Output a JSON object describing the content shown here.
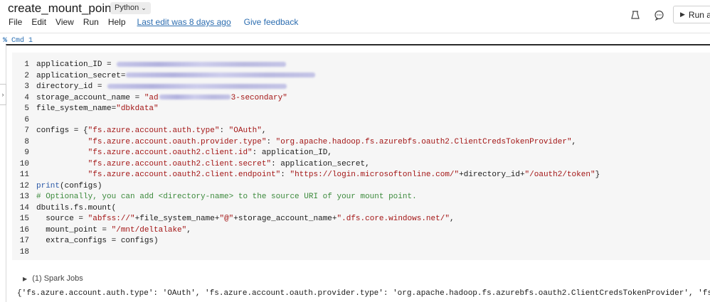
{
  "notebook": {
    "title": "create_mount_point",
    "language": "Python",
    "menu": [
      "File",
      "Edit",
      "View",
      "Run",
      "Help"
    ],
    "last_edit": "Last edit was 8 days ago",
    "feedback": "Give feedback",
    "run_label": "Run a"
  },
  "cell": {
    "cmd_icon": "%",
    "cmd_label": "Cmd 1"
  },
  "code": {
    "l1": "application_ID = ",
    "l2": "application_secret=",
    "l3": "directory_id = ",
    "l4a": "storage_account_name = ",
    "l4b": "\"ad",
    "l4c": "3-secondary\"",
    "l5a": "file_system_name=",
    "l5b": "\"dbkdata\"",
    "l7a": "configs = {",
    "l7b": "\"fs.azure.account.auth.type\"",
    "l7c": ": ",
    "l7d": "\"OAuth\"",
    "l7e": ",",
    "l8a": "           ",
    "l8b": "\"fs.azure.account.oauth.provider.type\"",
    "l8c": ": ",
    "l8d": "\"org.apache.hadoop.fs.azurebfs.oauth2.ClientCredsTokenProvider\"",
    "l8e": ",",
    "l9a": "           ",
    "l9b": "\"fs.azure.account.oauth2.client.id\"",
    "l9c": ": application_ID,",
    "l10a": "           ",
    "l10b": "\"fs.azure.account.oauth2.client.secret\"",
    "l10c": ": application_secret,",
    "l11a": "           ",
    "l11b": "\"fs.azure.account.oauth2.client.endpoint\"",
    "l11c": ": ",
    "l11d": "\"https://login.microsoftonline.com/\"",
    "l11e": "+directory_id+",
    "l11f": "\"/oauth2/token\"",
    "l11g": "}",
    "l12a": "print",
    "l12b": "(configs)",
    "l13": "# Optionally, you can add <directory-name> to the source URI of your mount point.",
    "l14": "dbutils.fs.mount(",
    "l15a": "  source = ",
    "l15b": "\"abfss://\"",
    "l15c": "+file_system_name+",
    "l15d": "\"@\"",
    "l15e": "+storage_account_name+",
    "l15f": "\".dfs.core.windows.net/\"",
    "l15g": ",",
    "l16a": "  mount_point = ",
    "l16b": "\"/mnt/deltalake\"",
    "l16c": ",",
    "l17": "  extra_configs = configs)"
  },
  "line_numbers": [
    "1",
    "2",
    "3",
    "4",
    "5",
    "6",
    "7",
    "8",
    "9",
    "10",
    "11",
    "12",
    "13",
    "14",
    "15",
    "16",
    "17",
    "18"
  ],
  "spark_jobs": "(1) Spark Jobs",
  "output_text": "{'fs.azure.account.auth.type': 'OAuth', 'fs.azure.account.oauth.provider.type': 'org.apache.hadoop.fs.azurebfs.oauth2.ClientCredsTokenProvider', 'fs.azu",
  "icons": {
    "profile": "user-icon",
    "comments": "comment-icon",
    "run": "play-icon"
  }
}
